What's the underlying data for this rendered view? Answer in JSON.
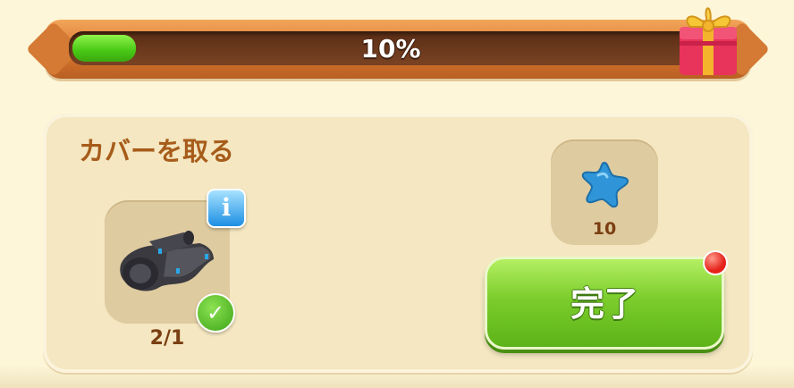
{
  "progress": {
    "percent_label": "10%",
    "value": 0.1,
    "fill_color": "#48c714"
  },
  "gift": {
    "icon": "gift-box-icon"
  },
  "quest": {
    "title": "カバーを取る",
    "item": {
      "icon": "tarp-cover-icon",
      "count_label": "2/1",
      "info_icon": "info-icon",
      "info_glyph": "i",
      "completed_icon": "checkmark-icon",
      "completed_glyph": "✓"
    },
    "reward": {
      "icon": "blue-star-icon",
      "amount": "10"
    },
    "complete_button": {
      "label": "完了",
      "color": "#7ccd2c"
    },
    "notification_color": "#e5231a"
  }
}
